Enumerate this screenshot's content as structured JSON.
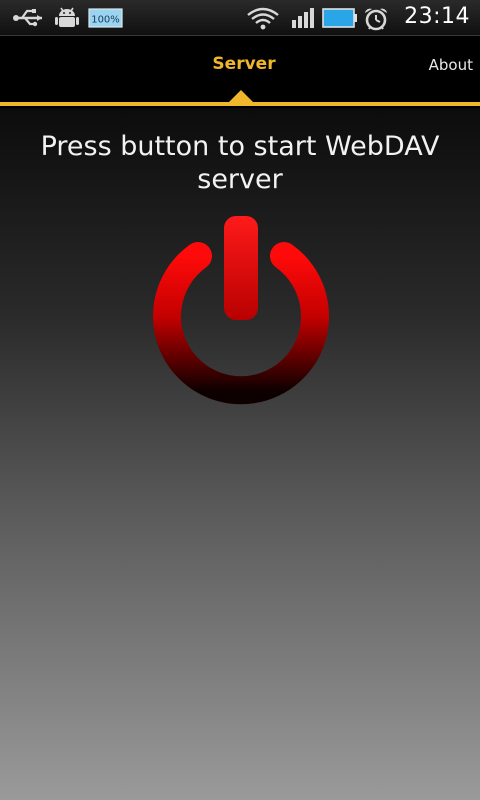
{
  "status_bar": {
    "battery_percent": "100%",
    "time": "23:14",
    "icons": [
      "usb-icon",
      "android-debug-icon",
      "battery-percent-icon",
      "wifi-icon",
      "signal-icon",
      "battery-icon",
      "alarm-icon"
    ]
  },
  "tabs": [
    {
      "label": "Server",
      "selected": true
    },
    {
      "label": "About",
      "selected": false
    }
  ],
  "main": {
    "prompt": "Press button to start WebDAV server",
    "power_button_icon": "power-icon"
  },
  "colors": {
    "accent": "#f1b72c",
    "power_red": "#e00000",
    "power_dark": "#1a0000"
  }
}
